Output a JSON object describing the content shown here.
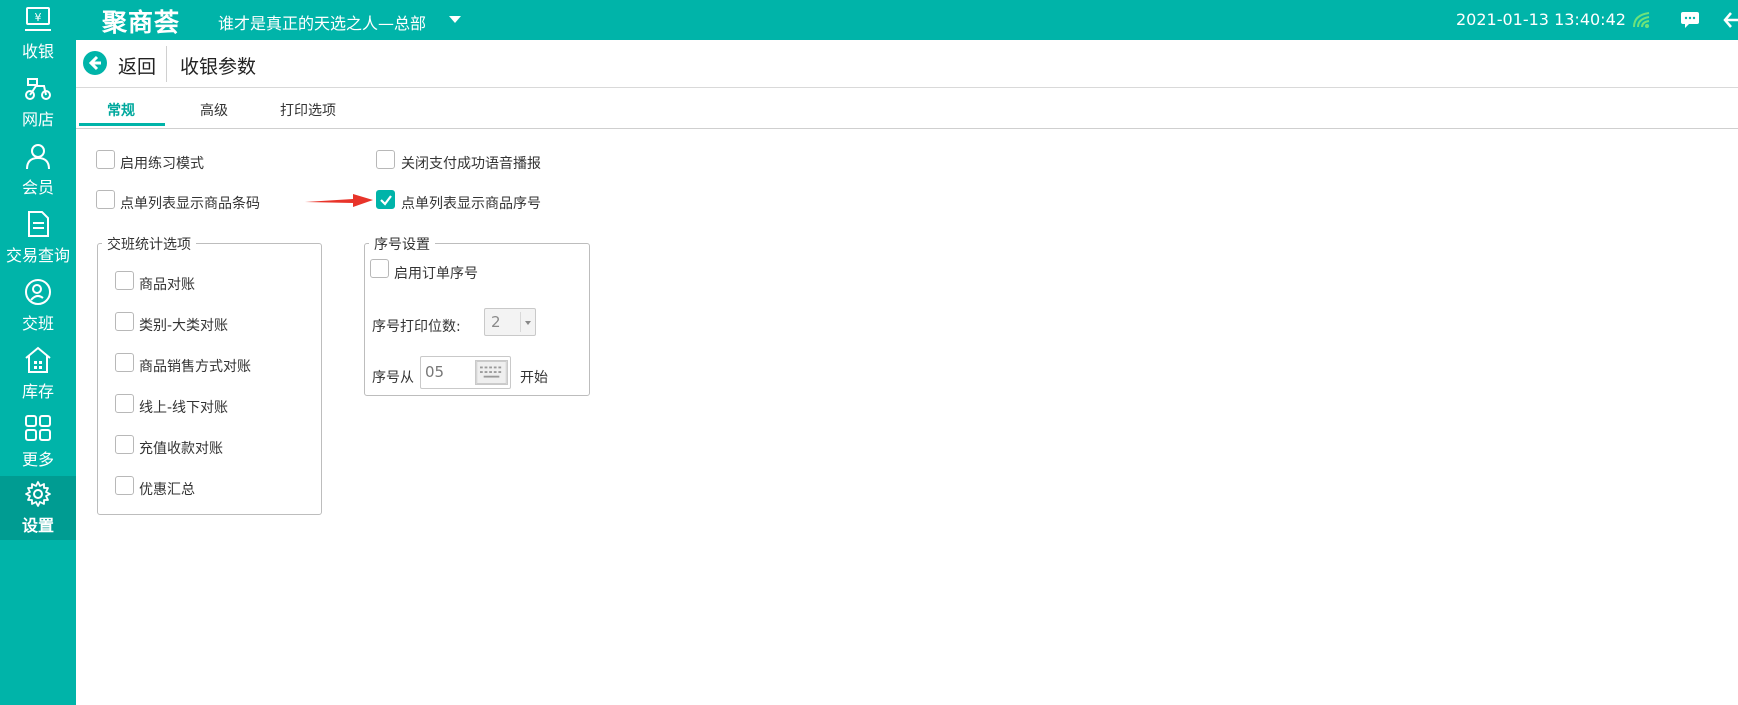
{
  "topbar": {
    "logo": "聚商荟",
    "store_name": "谁才是真正的天选之人—总部",
    "datetime": "2021-01-13 13:40:42"
  },
  "sidebar": {
    "items": [
      {
        "label": "收银",
        "icon": "cashier-icon"
      },
      {
        "label": "网店",
        "icon": "scooter-icon"
      },
      {
        "label": "会员",
        "icon": "member-icon"
      },
      {
        "label": "交易查询",
        "icon": "document-icon"
      },
      {
        "label": "交班",
        "icon": "shift-icon"
      },
      {
        "label": "库存",
        "icon": "warehouse-icon"
      },
      {
        "label": "更多",
        "icon": "grid-icon"
      },
      {
        "label": "设置",
        "icon": "gear-icon",
        "active": true
      }
    ]
  },
  "header": {
    "back_label": "返回",
    "title": "收银参数"
  },
  "tabs": [
    {
      "label": "常规",
      "active": true
    },
    {
      "label": "高级"
    },
    {
      "label": "打印选项"
    }
  ],
  "options": {
    "practice_mode": {
      "label": "启用练习模式",
      "checked": false
    },
    "close_pay_voice": {
      "label": "关闭支付成功语音播报",
      "checked": false
    },
    "show_barcode": {
      "label": "点单列表显示商品条码",
      "checked": false
    },
    "show_serial": {
      "label": "点单列表显示商品序号",
      "checked": true
    }
  },
  "shift_stats": {
    "title": "交班统计选项",
    "items": [
      {
        "label": "商品对账",
        "checked": false
      },
      {
        "label": "类别-大类对账",
        "checked": false
      },
      {
        "label": "商品销售方式对账",
        "checked": false
      },
      {
        "label": "线上-线下对账",
        "checked": false
      },
      {
        "label": "充值收款对账",
        "checked": false
      },
      {
        "label": "优惠汇总",
        "checked": false
      }
    ]
  },
  "serial_settings": {
    "title": "序号设置",
    "enable_label": "启用订单序号",
    "enable_checked": false,
    "digits_label": "序号打印位数:",
    "digits_value": "2",
    "start_label": "序号从",
    "start_value": "05",
    "start_suffix": "开始"
  },
  "colors": {
    "accent": "#00b4a9",
    "arrow": "#e8342a"
  }
}
